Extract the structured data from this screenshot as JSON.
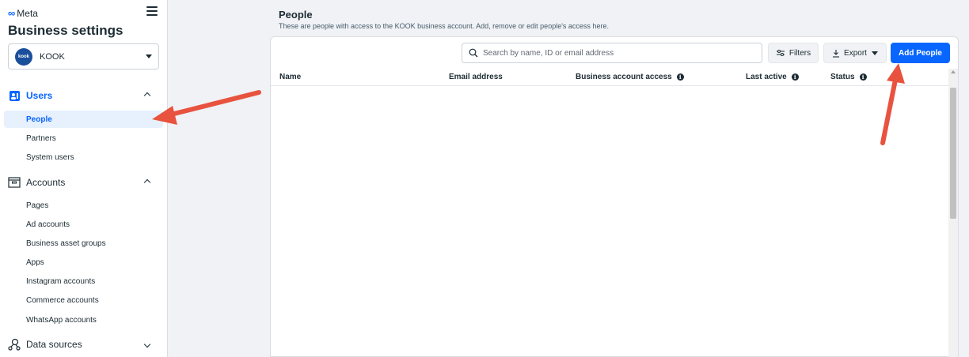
{
  "brand": {
    "logo_symbol": "∞",
    "name": "Meta"
  },
  "sidebar": {
    "title": "Business settings",
    "account": {
      "avatar_text": "kook",
      "name": "KOOK"
    },
    "sections": [
      {
        "label": "Users",
        "icon": "users-icon",
        "expanded": true,
        "items": [
          {
            "label": "People",
            "active": true
          },
          {
            "label": "Partners"
          },
          {
            "label": "System users"
          }
        ]
      },
      {
        "label": "Accounts",
        "icon": "accounts-icon",
        "expanded": true,
        "items": [
          {
            "label": "Pages"
          },
          {
            "label": "Ad accounts"
          },
          {
            "label": "Business asset groups"
          },
          {
            "label": "Apps"
          },
          {
            "label": "Instagram accounts"
          },
          {
            "label": "Commerce accounts"
          },
          {
            "label": "WhatsApp accounts"
          }
        ]
      },
      {
        "label": "Data sources",
        "icon": "data-sources-icon",
        "expanded": false,
        "items": []
      }
    ]
  },
  "main": {
    "title": "People",
    "subtitle": "These are people with access to the KOOK business account. Add, remove or edit people's access here.",
    "search_placeholder": "Search by name, ID or email address",
    "filters_label": "Filters",
    "export_label": "Export",
    "add_label": "Add People",
    "columns": [
      "Name",
      "Email address",
      "Business account access",
      "Last active",
      "Status"
    ],
    "rows": []
  },
  "colors": {
    "accent": "#0866ff",
    "annotation_arrow": "#e8533f"
  }
}
